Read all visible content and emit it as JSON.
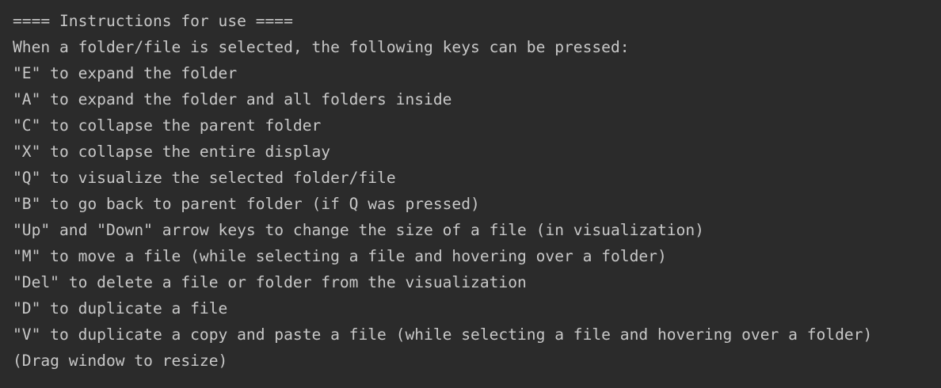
{
  "console": {
    "lines": [
      "==== Instructions for use ====",
      "When a folder/file is selected, the following keys can be pressed:",
      "\"E\" to expand the folder",
      "\"A\" to expand the folder and all folders inside",
      "\"C\" to collapse the parent folder",
      "\"X\" to collapse the entire display",
      "\"Q\" to visualize the selected folder/file",
      "\"B\" to go back to parent folder (if Q was pressed)",
      "\"Up\" and \"Down\" arrow keys to change the size of a file (in visualization)",
      "\"M\" to move a file (while selecting a file and hovering over a folder)",
      "\"Del\" to delete a file or folder from the visualization",
      "\"D\" to duplicate a file",
      "\"V\" to duplicate a copy and paste a file (while selecting a file and hovering over a folder)",
      "(Drag window to resize)"
    ],
    "colors": {
      "background": "#2b2b2b",
      "text": "#c8c8c8"
    }
  }
}
